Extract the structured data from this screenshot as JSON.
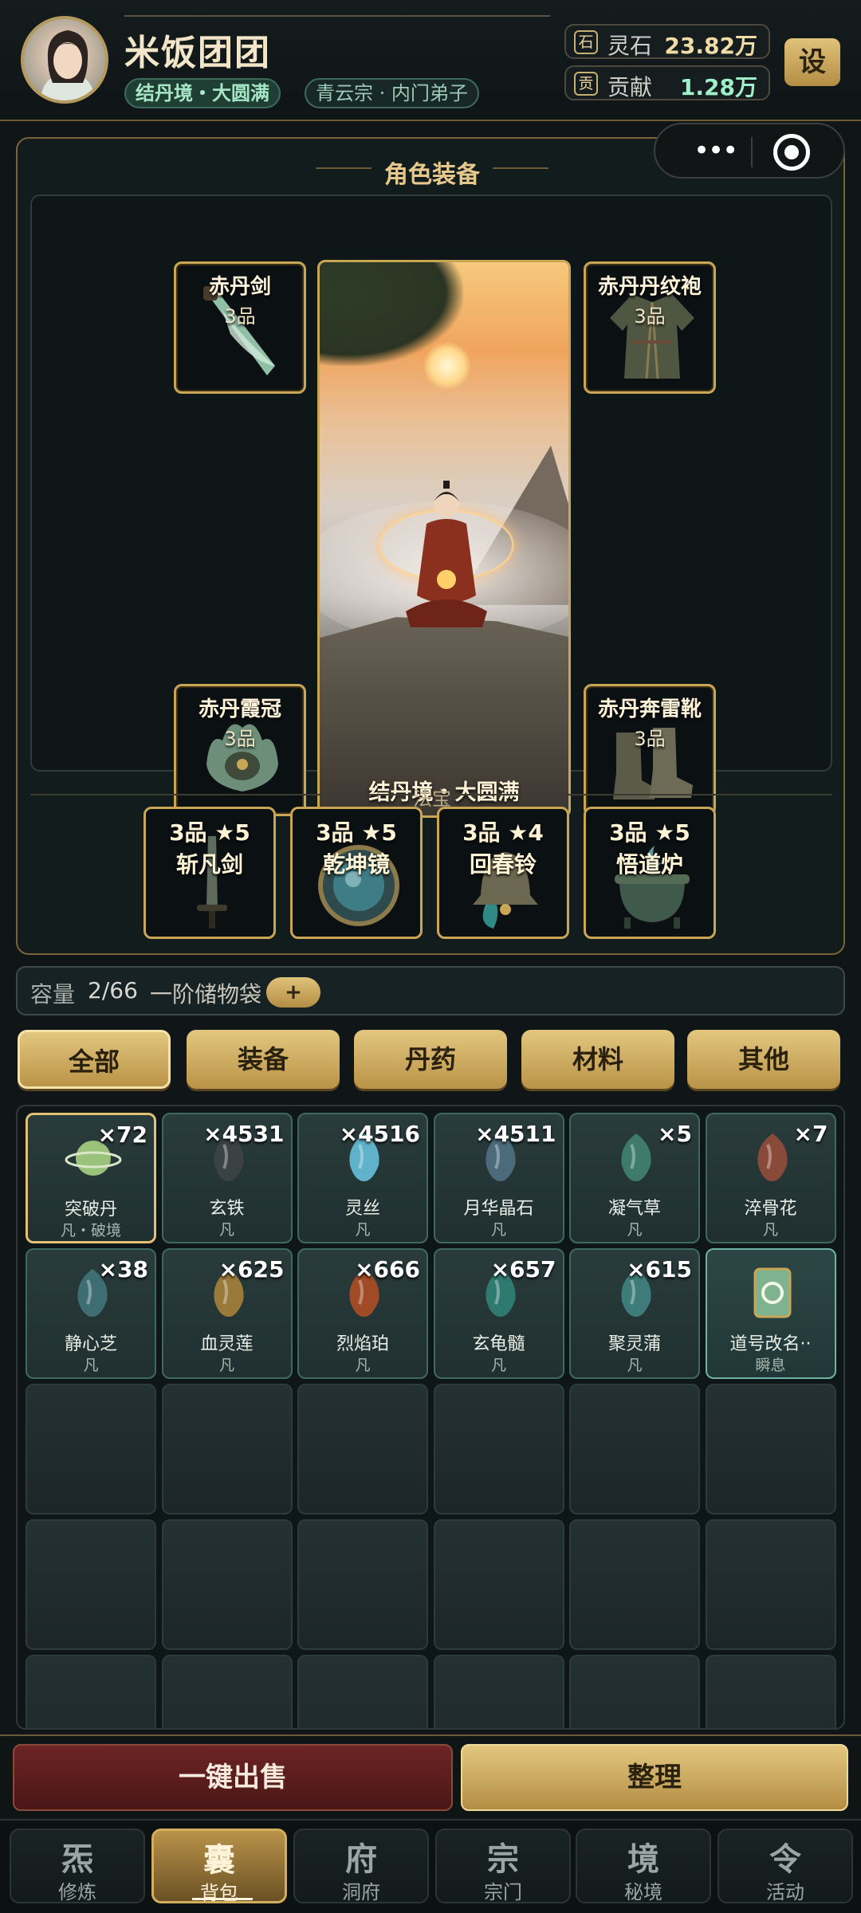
{
  "header": {
    "player_name": "米饭团团",
    "realm_tag": "结丹境・大圆满",
    "sect_tag": "青云宗 · 内门弟子",
    "resources": [
      {
        "icon_text": "石",
        "icon": "spirit-stone-icon",
        "label": "灵石",
        "value": "23.82万"
      },
      {
        "icon_text": "贡",
        "icon": "contribution-icon",
        "label": "贡献",
        "value": "1.28万"
      }
    ],
    "settings_label": "设"
  },
  "capsule": {
    "more": "•••"
  },
  "equipment": {
    "title": "角色装备",
    "slots": [
      {
        "name": "赤丹剑",
        "grade": "3品",
        "icon": "sword-icon"
      },
      {
        "name": "赤丹丹纹袍",
        "grade": "3品",
        "icon": "robe-icon"
      },
      {
        "name": "赤丹霞冠",
        "grade": "3品",
        "icon": "crown-icon"
      },
      {
        "name": "赤丹奔雷靴",
        "grade": "3品",
        "icon": "boots-icon"
      }
    ],
    "portrait_caption": "结丹境・大圆满",
    "fabao_label": "法宝",
    "fabao": [
      {
        "grade": "3品 ★5",
        "name": "斩凡剑",
        "icon": "blade-icon"
      },
      {
        "grade": "3品 ★5",
        "name": "乾坤镜",
        "icon": "mirror-icon"
      },
      {
        "grade": "3品 ★4",
        "name": "回春铃",
        "icon": "bell-icon"
      },
      {
        "grade": "3品 ★5",
        "name": "悟道炉",
        "icon": "cauldron-icon"
      }
    ]
  },
  "capacity": {
    "label": "容量",
    "value": "2/66",
    "bag_name": "一阶储物袋",
    "expand_label": "+"
  },
  "filters": {
    "tabs": [
      "全部",
      "装备",
      "丹药",
      "材料",
      "其他"
    ],
    "active": 0
  },
  "inventory": {
    "items": [
      {
        "name": "突破丹",
        "rarity": "凡・破境",
        "count": "×72",
        "icon": "pill-planet-icon",
        "color": "#9bc27a"
      },
      {
        "name": "玄铁",
        "rarity": "凡",
        "count": "×4531",
        "icon": "iron-ore-icon",
        "color": "#3b4244"
      },
      {
        "name": "灵丝",
        "rarity": "凡",
        "count": "×4516",
        "icon": "spirit-silk-icon",
        "color": "#5fb2c9"
      },
      {
        "name": "月华晶石",
        "rarity": "凡",
        "count": "×4511",
        "icon": "crystal-icon",
        "color": "#4b6b7a"
      },
      {
        "name": "凝气草",
        "rarity": "凡",
        "count": "×5",
        "icon": "herb-icon",
        "color": "#3e7b68"
      },
      {
        "name": "淬骨花",
        "rarity": "凡",
        "count": "×7",
        "icon": "flower-icon",
        "color": "#8a4a3a"
      },
      {
        "name": "静心芝",
        "rarity": "凡",
        "count": "×38",
        "icon": "mushroom-icon",
        "color": "#3e6d72"
      },
      {
        "name": "血灵莲",
        "rarity": "凡",
        "count": "×625",
        "icon": "lotus-icon",
        "color": "#9a7a3a"
      },
      {
        "name": "烈焰珀",
        "rarity": "凡",
        "count": "×666",
        "icon": "amber-icon",
        "color": "#a04a26"
      },
      {
        "name": "玄龟髓",
        "rarity": "凡",
        "count": "×657",
        "icon": "droplet-icon",
        "color": "#2f7a70"
      },
      {
        "name": "聚灵蒲",
        "rarity": "凡",
        "count": "×615",
        "icon": "reed-icon",
        "color": "#3d7c7a"
      },
      {
        "name": "道号改名··",
        "rarity": "瞬息",
        "count": "",
        "icon": "rename-card-icon",
        "color": "#7fb28f"
      }
    ]
  },
  "actions": {
    "sell_all": "一键出售",
    "sort": "整理"
  },
  "nav": [
    {
      "glyph": "炁",
      "label": "修炼"
    },
    {
      "glyph": "囊",
      "label": "背包"
    },
    {
      "glyph": "府",
      "label": "洞府"
    },
    {
      "glyph": "宗",
      "label": "宗门"
    },
    {
      "glyph": "境",
      "label": "秘境"
    },
    {
      "glyph": "令",
      "label": "活动"
    }
  ],
  "nav_active": 1
}
